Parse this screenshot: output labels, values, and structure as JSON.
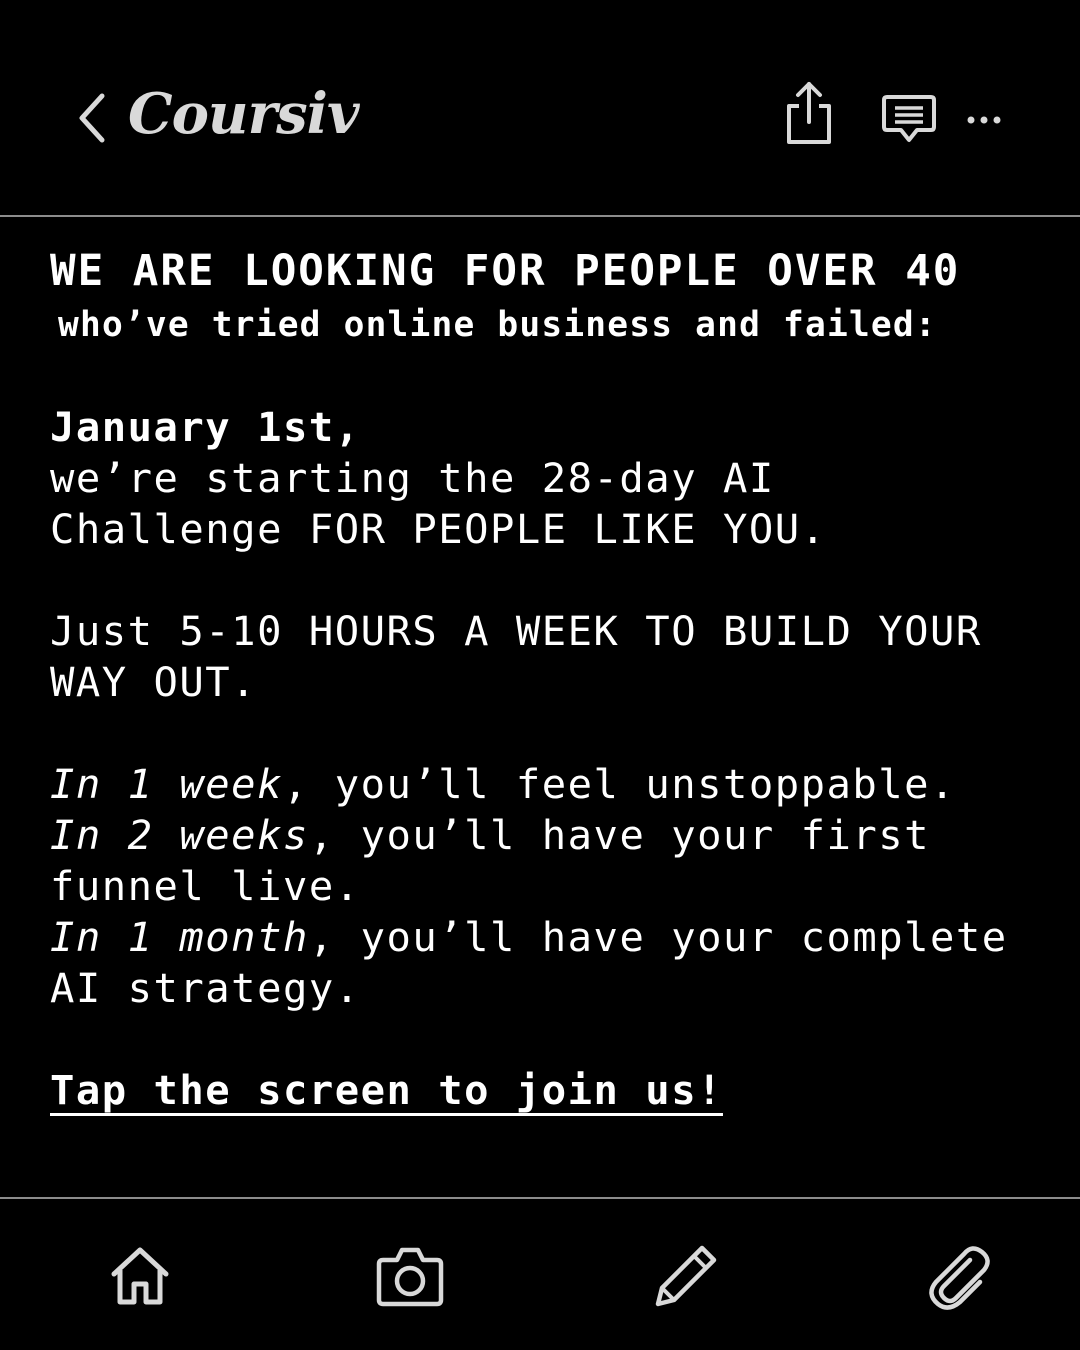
{
  "header": {
    "logo_text": "Coursiv",
    "icons": {
      "back": "chevron-left-icon",
      "share": "share-icon",
      "comment": "comment-icon",
      "more": "more-icon"
    }
  },
  "post": {
    "headline": "WE ARE LOOKING FOR PEOPLE OVER 40",
    "subheadline": "who’ve tried online business and failed:",
    "date_line": "January 1st,",
    "intro_line1": "we’re starting the 28-day AI",
    "intro_line2": "Challenge FOR PEOPLE LIKE YOU.",
    "hours_line1": "Just 5-10 HOURS A WEEK TO BUILD YOUR",
    "hours_line2": "WAY OUT.",
    "milestones": [
      {
        "when": "In 1 week",
        "rest": ", you’ll feel unstoppable."
      },
      {
        "when": "In 2 weeks",
        "rest": ", you’ll have your first"
      },
      {
        "when": "In 1 month",
        "rest": ", you’ll have your complete"
      }
    ],
    "milestone2_cont": "funnel live.",
    "milestone3_cont": "AI strategy.",
    "cta": "Tap the screen to join us!"
  },
  "toolbar": {
    "icons": [
      "home-icon",
      "camera-icon",
      "pencil-icon",
      "paperclip-icon"
    ]
  },
  "colors": {
    "background": "#000000",
    "text": "#ffffff",
    "icon": "#d9d9d9",
    "divider": "#8c8c8c"
  }
}
